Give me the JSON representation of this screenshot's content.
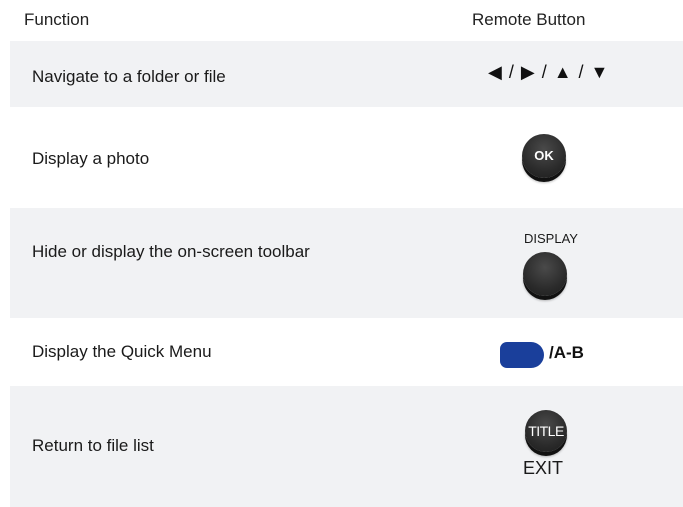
{
  "header": {
    "function_label": "Function",
    "button_label": "Remote Button"
  },
  "rows": [
    {
      "function": "Navigate to a folder or file",
      "button": {
        "type": "arrows",
        "text": "◀ / ▶ / ▲ / ▼"
      }
    },
    {
      "function": "Display a photo",
      "button": {
        "type": "round",
        "text": "OK"
      }
    },
    {
      "function": "Hide or display the on-screen toolbar",
      "button": {
        "type": "round",
        "caption": "DISPLAY"
      }
    },
    {
      "function": "Display the Quick Menu",
      "button": {
        "type": "blue",
        "text": "/A-B",
        "color": "#1a3f9b"
      }
    },
    {
      "function": "Return to file list",
      "button": {
        "type": "round",
        "text": "TITLE",
        "caption": "EXIT"
      }
    }
  ],
  "colors": {
    "row_shade": "#f1f2f4",
    "button_dark": "#2b2b2b",
    "blue_button": "#1a3f9b"
  }
}
